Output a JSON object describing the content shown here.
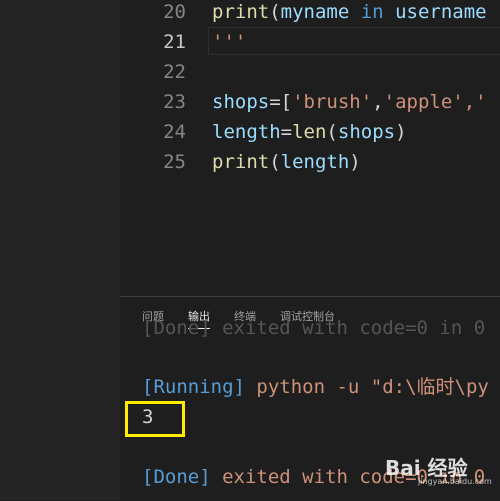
{
  "editor": {
    "lines": [
      {
        "num": "20",
        "parts": [
          {
            "t": "print",
            "c": "fn"
          },
          {
            "t": "(",
            "c": "op"
          },
          {
            "t": "myname",
            "c": "var"
          },
          {
            "t": " in ",
            "c": "kw"
          },
          {
            "t": "username",
            "c": "var"
          }
        ]
      },
      {
        "num": "21",
        "parts": [
          {
            "t": "'''",
            "c": "str"
          }
        ]
      },
      {
        "num": "22",
        "parts": []
      },
      {
        "num": "23",
        "parts": [
          {
            "t": "shops",
            "c": "var"
          },
          {
            "t": "=[",
            "c": "op"
          },
          {
            "t": "'brush'",
            "c": "str"
          },
          {
            "t": ",",
            "c": "op"
          },
          {
            "t": "'apple'",
            "c": "str"
          },
          {
            "t": ",'",
            "c": "str"
          }
        ]
      },
      {
        "num": "24",
        "parts": [
          {
            "t": "length",
            "c": "var"
          },
          {
            "t": "=",
            "c": "op"
          },
          {
            "t": "len",
            "c": "fn"
          },
          {
            "t": "(",
            "c": "op"
          },
          {
            "t": "shops",
            "c": "var"
          },
          {
            "t": ")",
            "c": "op"
          }
        ]
      },
      {
        "num": "25",
        "parts": [
          {
            "t": "print",
            "c": "fn"
          },
          {
            "t": "(",
            "c": "op"
          },
          {
            "t": "length",
            "c": "var"
          },
          {
            "t": ")",
            "c": "op"
          }
        ]
      }
    ]
  },
  "panel": {
    "tabs": [
      "问题",
      "输出",
      "终端",
      "调试控制台"
    ],
    "active_tab": "输出",
    "output": {
      "ghost": "[Done] exited with code=0 in 0",
      "running_label": "[Running]",
      "running_cmd": "python -u \"d:\\临时\\py",
      "result": "3",
      "done_label": "[Done]",
      "done_text": "exited with code=0 in 0"
    }
  },
  "watermark": {
    "brand": "Bai 经验",
    "url": "jingyan.baidu.com"
  },
  "colors": {
    "highlight": "#ffeb00",
    "keyword": "#569cd6",
    "string": "#ce9178",
    "function": "#dcdcaa",
    "variable": "#9cdcfe"
  }
}
